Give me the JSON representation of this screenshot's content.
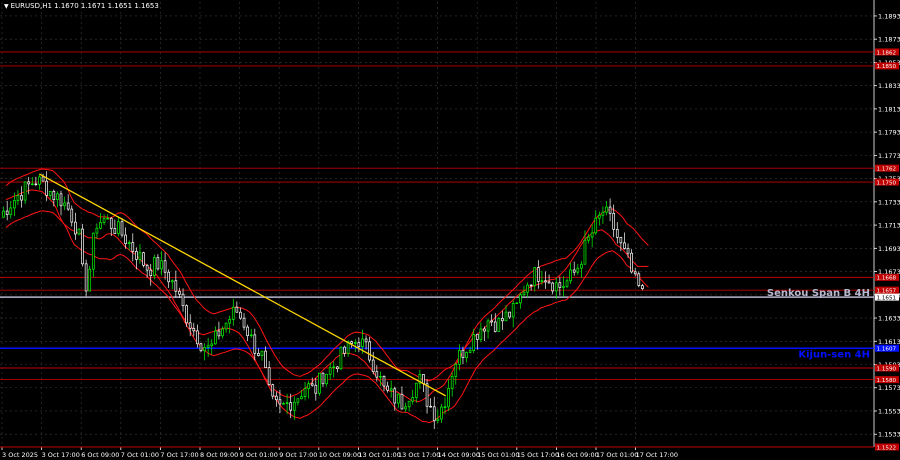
{
  "header": {
    "symbol_icon": "down-triangle-icon",
    "title": "EURUSD,H1  1.1670 1.1671 1.1651 1.1653"
  },
  "colors": {
    "background": "#000000",
    "candle_up": "#00ff00",
    "candle_down": "#ffffff",
    "grid": "#3a3a3a",
    "level_line": "#c00000",
    "ichimoku_band": "#ff1414",
    "trend_line": "#ffd700",
    "senkou_line": "#b8b8d0",
    "kijun_line": "#0010ff",
    "axis_text": "#ffffff"
  },
  "chart_data": {
    "type": "candlestick",
    "y_axis": {
      "range": [
        1.1522,
        1.1905
      ],
      "tick_labels": [
        "1.1893",
        "1.1873",
        "1.1853",
        "1.1833",
        "1.1813",
        "1.1793",
        "1.1773",
        "1.1753",
        "1.1733",
        "1.1713",
        "1.1693",
        "1.1673",
        "1.1653",
        "1.1633",
        "1.1613",
        "1.1593",
        "1.1573",
        "1.1553",
        "1.1533"
      ]
    },
    "x_axis": {
      "tick_labels": [
        "3 Oct 2025",
        "3 Oct 17:00",
        "6 Oct 09:00",
        "7 Oct 01:00",
        "7 Oct 17:00",
        "8 Oct 09:00",
        "9 Oct 01:00",
        "9 Oct 17:00",
        "10 Oct 09:00",
        "13 Oct 01:00",
        "13 Oct 17:00",
        "14 Oct 09:00",
        "15 Oct 01:00",
        "15 Oct 17:00",
        "16 Oct 09:00",
        "17 Oct 01:00",
        "17 Oct 17:00"
      ]
    },
    "price_levels": [
      {
        "label": "1.1862",
        "value": 1.1862,
        "color": "red"
      },
      {
        "label": "1.1850",
        "value": 1.185,
        "color": "red"
      },
      {
        "label": "1.1762",
        "value": 1.1762,
        "color": "red"
      },
      {
        "label": "1.1750",
        "value": 1.175,
        "color": "red"
      },
      {
        "label": "1.1668",
        "value": 1.1668,
        "color": "red"
      },
      {
        "label": "1.1657",
        "value": 1.1657,
        "color": "red"
      },
      {
        "label": "1.1651",
        "value": 1.1651,
        "color": "white"
      },
      {
        "label": "1.1607",
        "value": 1.1607,
        "color": "blue"
      },
      {
        "label": "1.1590",
        "value": 1.159,
        "color": "red"
      },
      {
        "label": "1.1580",
        "value": 1.158,
        "color": "red"
      },
      {
        "label": "1.1522",
        "value": 1.1522,
        "color": "red"
      }
    ],
    "annotations": [
      {
        "text": "Senkou Span B 4H",
        "value": 1.1655,
        "color": "#b8b8d0"
      },
      {
        "text": "Kijun-sen 4H",
        "value": 1.1602,
        "color": "#0010ff"
      }
    ],
    "trend_line": {
      "from_x": 0.045,
      "from_price": 1.1757,
      "to_x": 0.51,
      "to_price": 1.1566
    },
    "close_path": [
      [
        0.0,
        1.172
      ],
      [
        0.01,
        1.173
      ],
      [
        0.02,
        1.1738
      ],
      [
        0.03,
        1.1745
      ],
      [
        0.04,
        1.1752
      ],
      [
        0.05,
        1.1748
      ],
      [
        0.06,
        1.174
      ],
      [
        0.07,
        1.1735
      ],
      [
        0.08,
        1.1725
      ],
      [
        0.09,
        1.1705
      ],
      [
        0.095,
        1.1668
      ],
      [
        0.1,
        1.166
      ],
      [
        0.105,
        1.169
      ],
      [
        0.11,
        1.1715
      ],
      [
        0.12,
        1.1718
      ],
      [
        0.13,
        1.1712
      ],
      [
        0.14,
        1.1705
      ],
      [
        0.15,
        1.1695
      ],
      [
        0.16,
        1.1685
      ],
      [
        0.17,
        1.1675
      ],
      [
        0.18,
        1.168
      ],
      [
        0.19,
        1.1672
      ],
      [
        0.2,
        1.166
      ],
      [
        0.21,
        1.164
      ],
      [
        0.22,
        1.1625
      ],
      [
        0.23,
        1.1612
      ],
      [
        0.24,
        1.1605
      ],
      [
        0.25,
        1.162
      ],
      [
        0.26,
        1.163
      ],
      [
        0.27,
        1.164
      ],
      [
        0.28,
        1.1628
      ],
      [
        0.29,
        1.161
      ],
      [
        0.3,
        1.16
      ],
      [
        0.31,
        1.156
      ],
      [
        0.32,
        1.1555
      ],
      [
        0.33,
        1.156
      ],
      [
        0.34,
        1.1565
      ],
      [
        0.35,
        1.1575
      ],
      [
        0.36,
        1.157
      ],
      [
        0.37,
        1.1585
      ],
      [
        0.38,
        1.159
      ],
      [
        0.39,
        1.16
      ],
      [
        0.4,
        1.1608
      ],
      [
        0.41,
        1.1615
      ],
      [
        0.42,
        1.1605
      ],
      [
        0.43,
        1.159
      ],
      [
        0.44,
        1.157
      ],
      [
        0.45,
        1.1565
      ],
      [
        0.46,
        1.156
      ],
      [
        0.47,
        1.157
      ],
      [
        0.48,
        1.158
      ],
      [
        0.49,
        1.156
      ],
      [
        0.5,
        1.1548
      ],
      [
        0.51,
        1.1565
      ],
      [
        0.52,
        1.1595
      ],
      [
        0.53,
        1.1605
      ],
      [
        0.54,
        1.1615
      ],
      [
        0.55,
        1.1625
      ],
      [
        0.56,
        1.1632
      ],
      [
        0.57,
        1.1628
      ],
      [
        0.58,
        1.1635
      ],
      [
        0.59,
        1.164
      ],
      [
        0.6,
        1.166
      ],
      [
        0.61,
        1.167
      ],
      [
        0.62,
        1.1672
      ],
      [
        0.63,
        1.1665
      ],
      [
        0.64,
        1.166
      ],
      [
        0.65,
        1.1665
      ],
      [
        0.66,
        1.1675
      ],
      [
        0.67,
        1.1695
      ],
      [
        0.68,
        1.171
      ],
      [
        0.69,
        1.1725
      ],
      [
        0.7,
        1.1715
      ],
      [
        0.71,
        1.1695
      ],
      [
        0.72,
        1.168
      ],
      [
        0.725,
        1.1665
      ],
      [
        0.73,
        1.166
      ],
      [
        0.735,
        1.1653
      ]
    ]
  }
}
